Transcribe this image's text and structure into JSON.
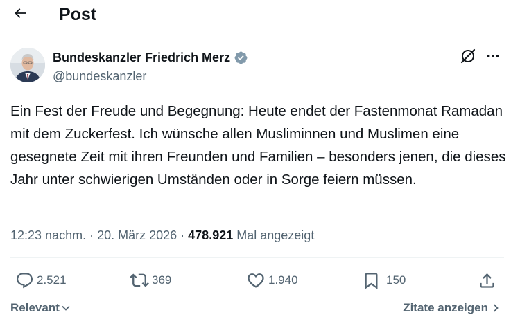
{
  "header": {
    "title": "Post",
    "back_icon": "arrow-left-icon"
  },
  "author": {
    "name": "Bundeskanzler Friedrich Merz",
    "handle": "@bundeskanzler",
    "verified_icon": "verified-badge-icon",
    "verified_color": "#829aab"
  },
  "post": {
    "text": "Ein Fest der Freude und Begegnung: Heute endet der Fastenmonat Ramadan mit dem Zuckerfest. Ich wünsche allen Musliminnen und Muslimen eine gesegnete Zeit mit ihren Freunden und Familien – besonders jenen, die dieses Jahr unter schwierigen Umständen oder in Sorge feiern müssen."
  },
  "meta": {
    "time": "12:23 nachm.",
    "separator": " · ",
    "date": "20. März 2026",
    "views_count": "478.921",
    "views_label": "Mal angezeigt"
  },
  "actions": {
    "replies": "2.521",
    "reposts": "369",
    "likes": "1.940",
    "bookmarks": "150"
  },
  "footer": {
    "sort_label": "Relevant",
    "quotes_label": "Zitate anzeigen"
  },
  "colors": {
    "text_primary": "#0f1419",
    "text_secondary": "#536471",
    "divider": "#eff3f4"
  }
}
